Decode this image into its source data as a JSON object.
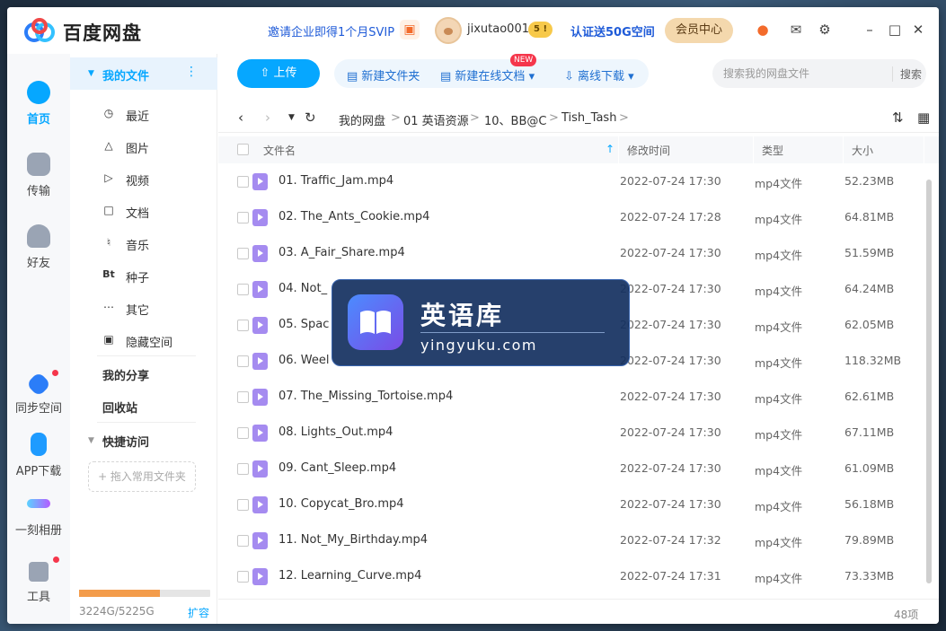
{
  "titlebar": {
    "app_title": "百度网盘",
    "invite_text": "邀请企业即得1个月SVIP",
    "username": "jixutao001",
    "level_badge": "5 !",
    "certify_text": "认证送50G空间",
    "vip_button": "会员中心",
    "icons": [
      "game-icon",
      "mail-icon",
      "settings-icon",
      "minimize-icon",
      "maximize-icon",
      "close-icon"
    ]
  },
  "rail": {
    "items": [
      {
        "label": "首页",
        "icon": "cloud-icon"
      },
      {
        "label": "传输",
        "icon": "transfer-icon"
      },
      {
        "label": "好友",
        "icon": "friends-icon"
      },
      {
        "label": "同步空间",
        "icon": "sync-icon"
      },
      {
        "label": "APP下载",
        "icon": "phone-icon"
      },
      {
        "label": "一刻相册",
        "icon": "album-icon"
      },
      {
        "label": "工具",
        "icon": "tools-icon"
      }
    ]
  },
  "sidebar": {
    "my_files": "我的文件",
    "items": [
      {
        "label": "最近",
        "icon": "clock-icon"
      },
      {
        "label": "图片",
        "icon": "image-icon"
      },
      {
        "label": "视频",
        "icon": "play-icon"
      },
      {
        "label": "文档",
        "icon": "doc-icon"
      },
      {
        "label": "音乐",
        "icon": "headphone-icon"
      },
      {
        "label": "种子",
        "icon": "bt-icon"
      },
      {
        "label": "其它",
        "icon": "more-icon"
      },
      {
        "label": "隐藏空间",
        "icon": "lock-icon"
      }
    ],
    "my_share": "我的分享",
    "recycle": "回收站",
    "quick_access": "快捷访问",
    "drag_hint": "+ 拖入常用文件夹",
    "storage_text": "3224G/5225G",
    "storage_fraction": 0.617,
    "expand": "扩容"
  },
  "toolbar": {
    "upload": "上传",
    "new_folder": "新建文件夹",
    "new_online_doc": "新建在线文档",
    "new_badge": "NEW",
    "offline_download": "离线下载",
    "search_placeholder": "搜索我的网盘文件",
    "search_button": "搜索"
  },
  "breadcrumb": [
    "我的网盘",
    "01 英语资源",
    "10、BB@C",
    "Tish_Tash"
  ],
  "table": {
    "headers": {
      "name": "文件名",
      "modified": "修改时间",
      "type": "类型",
      "size": "大小"
    },
    "rows": [
      {
        "name": "01. Traffic_Jam.mp4",
        "time": "2022-07-24 17:30",
        "type": "mp4文件",
        "size": "52.23MB"
      },
      {
        "name": "02. The_Ants_Cookie.mp4",
        "time": "2022-07-24 17:28",
        "type": "mp4文件",
        "size": "64.81MB"
      },
      {
        "name": "03. A_Fair_Share.mp4",
        "time": "2022-07-24 17:30",
        "type": "mp4文件",
        "size": "51.59MB"
      },
      {
        "name": "04. Not_",
        "time": "2022-07-24 17:30",
        "type": "mp4文件",
        "size": "64.24MB"
      },
      {
        "name": "05. Spac",
        "time": "2022-07-24 17:30",
        "type": "mp4文件",
        "size": "62.05MB"
      },
      {
        "name": "06. Weel",
        "time": "2022-07-24 17:30",
        "type": "mp4文件",
        "size": "118.32MB"
      },
      {
        "name": "07. The_Missing_Tortoise.mp4",
        "time": "2022-07-24 17:30",
        "type": "mp4文件",
        "size": "62.61MB"
      },
      {
        "name": "08. Lights_Out.mp4",
        "time": "2022-07-24 17:30",
        "type": "mp4文件",
        "size": "67.11MB"
      },
      {
        "name": "09. Cant_Sleep.mp4",
        "time": "2022-07-24 17:30",
        "type": "mp4文件",
        "size": "61.09MB"
      },
      {
        "name": "10. Copycat_Bro.mp4",
        "time": "2022-07-24 17:30",
        "type": "mp4文件",
        "size": "56.18MB"
      },
      {
        "name": "11. Not_My_Birthday.mp4",
        "time": "2022-07-24 17:32",
        "type": "mp4文件",
        "size": "79.89MB"
      },
      {
        "name": "12. Learning_Curve.mp4",
        "time": "2022-07-24 17:31",
        "type": "mp4文件",
        "size": "73.33MB"
      }
    ]
  },
  "footer": {
    "item_count": "48项"
  },
  "watermark": {
    "title": "英语库",
    "url": "yingyuku.com"
  },
  "colors": {
    "accent": "#06a7ff",
    "link": "#1f5bd8",
    "vip": "#f4d8ad",
    "video_icon": "#a58bf0"
  }
}
